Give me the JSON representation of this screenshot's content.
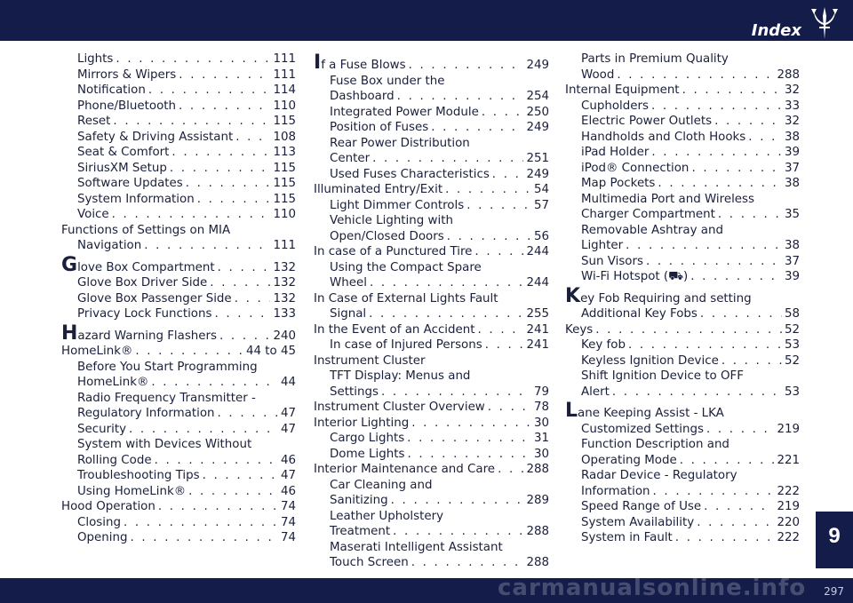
{
  "header": {
    "title": "Index"
  },
  "chapter_tab": "9",
  "footer": {
    "page_number": "297",
    "watermark": "carmanualsonline.info"
  },
  "columns": [
    [
      {
        "text": "Lights",
        "page": "111",
        "level": 1
      },
      {
        "text": "Mirrors & Wipers",
        "page": "111",
        "level": 1
      },
      {
        "text": "Notification",
        "page": "114",
        "level": 1
      },
      {
        "text": "Phone/Bluetooth",
        "page": "110",
        "level": 1
      },
      {
        "text": "Reset",
        "page": "115",
        "level": 1
      },
      {
        "text": "Safety & Driving Assistant",
        "page": "108",
        "level": 1
      },
      {
        "text": "Seat & Comfort",
        "page": "113",
        "level": 1
      },
      {
        "text": "SiriusXM Setup",
        "page": "115",
        "level": 1
      },
      {
        "text": "Software Updates",
        "page": "115",
        "level": 1
      },
      {
        "text": "System Information",
        "page": "115",
        "level": 1
      },
      {
        "text": "Voice",
        "page": "110",
        "level": 1
      },
      {
        "text": "Functions of Settings on MIA",
        "page": "",
        "level": 0
      },
      {
        "text": "Navigation",
        "page": "111",
        "level": 1
      },
      {
        "text": "Glove Box Compartment",
        "page": "132",
        "level": 0,
        "cap": true
      },
      {
        "text": "Glove Box Driver Side",
        "page": "132",
        "level": 1
      },
      {
        "text": "Glove Box Passenger Side",
        "page": "132",
        "level": 1
      },
      {
        "text": "Privacy Lock Functions",
        "page": "133",
        "level": 1
      },
      {
        "text": "Hazard Warning Flashers",
        "page": "240",
        "level": 0,
        "cap": true
      },
      {
        "text": "HomeLink®",
        "page": "44 to 45",
        "level": 0
      },
      {
        "text": "Before You Start Programming",
        "page": "",
        "level": 1
      },
      {
        "text": "HomeLink®",
        "page": "44",
        "level": 1
      },
      {
        "text": "Radio Frequency Transmitter -",
        "page": "",
        "level": 1
      },
      {
        "text": "Regulatory Information",
        "page": "47",
        "level": 1
      },
      {
        "text": "Security",
        "page": "47",
        "level": 1
      },
      {
        "text": "System with Devices Without",
        "page": "",
        "level": 1
      },
      {
        "text": "Rolling Code",
        "page": "46",
        "level": 1
      },
      {
        "text": "Troubleshooting Tips",
        "page": "47",
        "level": 1
      },
      {
        "text": "Using HomeLink®",
        "page": "46",
        "level": 1
      },
      {
        "text": "Hood Operation",
        "page": "74",
        "level": 0
      },
      {
        "text": "Closing",
        "page": "74",
        "level": 1
      },
      {
        "text": "Opening",
        "page": "74",
        "level": 1
      }
    ],
    [
      {
        "text": "If a Fuse Blows",
        "page": "249",
        "level": 0,
        "cap": true
      },
      {
        "text": "Fuse Box under the",
        "page": "",
        "level": 1
      },
      {
        "text": "Dashboard",
        "page": "254",
        "level": 1
      },
      {
        "text": "Integrated Power Module",
        "page": "250",
        "level": 1
      },
      {
        "text": "Position of Fuses",
        "page": "249",
        "level": 1
      },
      {
        "text": "Rear Power Distribution",
        "page": "",
        "level": 1
      },
      {
        "text": "Center",
        "page": "251",
        "level": 1
      },
      {
        "text": "Used Fuses Characteristics",
        "page": "249",
        "level": 1
      },
      {
        "text": "Illuminated Entry/Exit",
        "page": "54",
        "level": 0
      },
      {
        "text": "Light Dimmer Controls",
        "page": "57",
        "level": 1
      },
      {
        "text": "Vehicle Lighting with",
        "page": "",
        "level": 1
      },
      {
        "text": "Open/Closed Doors",
        "page": "56",
        "level": 1
      },
      {
        "text": "In case of a Punctured Tire",
        "page": "244",
        "level": 0
      },
      {
        "text": "Using the Compact Spare",
        "page": "",
        "level": 1
      },
      {
        "text": "Wheel",
        "page": "244",
        "level": 1
      },
      {
        "text": "In Case of External Lights Fault",
        "page": "",
        "level": 0
      },
      {
        "text": "Signal",
        "page": "255",
        "level": 1
      },
      {
        "text": "In the Event of an Accident",
        "page": "241",
        "level": 0
      },
      {
        "text": "In case of Injured Persons",
        "page": "241",
        "level": 1
      },
      {
        "text": "Instrument Cluster",
        "page": "",
        "level": 0
      },
      {
        "text": "TFT Display: Menus and",
        "page": "",
        "level": 1
      },
      {
        "text": "Settings",
        "page": "79",
        "level": 1
      },
      {
        "text": "Instrument Cluster Overview",
        "page": "78",
        "level": 0
      },
      {
        "text": "Interior Lighting",
        "page": "30",
        "level": 0
      },
      {
        "text": "Cargo Lights",
        "page": "31",
        "level": 1
      },
      {
        "text": "Dome Lights",
        "page": "30",
        "level": 1
      },
      {
        "text": "Interior Maintenance and Care",
        "page": "288",
        "level": 0
      },
      {
        "text": "Car Cleaning and",
        "page": "",
        "level": 1
      },
      {
        "text": "Sanitizing",
        "page": "289",
        "level": 1
      },
      {
        "text": "Leather Upholstery",
        "page": "",
        "level": 1
      },
      {
        "text": "Treatment",
        "page": "288",
        "level": 1
      },
      {
        "text": "Maserati Intelligent Assistant",
        "page": "",
        "level": 1
      },
      {
        "text": "Touch Screen",
        "page": "288",
        "level": 1
      }
    ],
    [
      {
        "text": "Parts in Premium Quality",
        "page": "",
        "level": 1
      },
      {
        "text": "Wood",
        "page": "288",
        "level": 1
      },
      {
        "text": "Internal Equipment",
        "page": "32",
        "level": 0
      },
      {
        "text": "Cupholders",
        "page": "33",
        "level": 1
      },
      {
        "text": "Electric Power Outlets",
        "page": "32",
        "level": 1
      },
      {
        "text": "Handholds and Cloth Hooks",
        "page": "38",
        "level": 1
      },
      {
        "text": "iPad Holder",
        "page": "39",
        "level": 1
      },
      {
        "text": "iPod® Connection",
        "page": "37",
        "level": 1
      },
      {
        "text": "Map Pockets",
        "page": "38",
        "level": 1
      },
      {
        "text": "Multimedia Port and Wireless",
        "page": "",
        "level": 1
      },
      {
        "text": "Charger Compartment",
        "page": "35",
        "level": 1
      },
      {
        "text": "Removable Ashtray and",
        "page": "",
        "level": 1
      },
      {
        "text": "Lighter",
        "page": "38",
        "level": 1
      },
      {
        "text": "Sun Visors",
        "page": "37",
        "level": 1
      },
      {
        "text": "Wi-Fi Hotspot (⛟)",
        "page": "39",
        "level": 1
      },
      {
        "text": "Key Fob Requiring and setting",
        "page": "",
        "level": 0,
        "cap": true
      },
      {
        "text": "Additional Key Fobs",
        "page": "58",
        "level": 1
      },
      {
        "text": "Keys",
        "page": "52",
        "level": 0
      },
      {
        "text": "Key fob",
        "page": "53",
        "level": 1
      },
      {
        "text": "Keyless Ignition Device",
        "page": "52",
        "level": 1
      },
      {
        "text": "Shift Ignition Device to OFF",
        "page": "",
        "level": 1
      },
      {
        "text": "Alert",
        "page": "53",
        "level": 1
      },
      {
        "text": "Lane Keeping Assist - LKA",
        "page": "",
        "level": 0,
        "cap": true
      },
      {
        "text": "Customized Settings",
        "page": "219",
        "level": 1
      },
      {
        "text": "Function Description and",
        "page": "",
        "level": 1
      },
      {
        "text": "Operating Mode",
        "page": "221",
        "level": 1
      },
      {
        "text": "Radar Device - Regulatory",
        "page": "",
        "level": 1
      },
      {
        "text": "Information",
        "page": "222",
        "level": 1
      },
      {
        "text": "Speed Range of Use",
        "page": "219",
        "level": 1
      },
      {
        "text": "System Availability",
        "page": "220",
        "level": 1
      },
      {
        "text": "System in Fault",
        "page": "222",
        "level": 1
      }
    ]
  ]
}
